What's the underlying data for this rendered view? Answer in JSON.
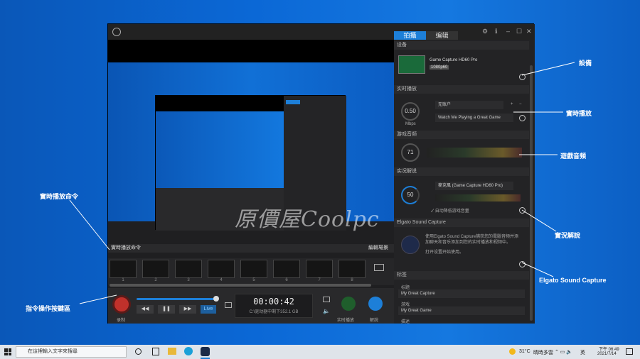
{
  "app": {
    "tabs": [
      {
        "label": "拍攝"
      },
      {
        "label": "编辑"
      }
    ],
    "watermark": "原價屋Coolpc"
  },
  "command_bar": {
    "label": "實時播放命令",
    "edit_scene": "編輯場景"
  },
  "thumbnails": [
    "1",
    "2",
    "3",
    "4",
    "5",
    "6",
    "7",
    "8"
  ],
  "controls": {
    "record_label": "录制",
    "live_label": "Live",
    "time": "00:00:42",
    "disk": "C:\\驱动器中剩下352.1 GB",
    "stream_label": "实时播放",
    "commentary_label": "解說"
  },
  "panel": {
    "device": {
      "header": "设备",
      "name": "Game Capture HD60 Pro",
      "badge": "1080p60"
    },
    "live": {
      "header": "实时播放",
      "gauge": "0.50",
      "unit": "Mbps",
      "service": "无账户",
      "title": "Watch Me Playing a Great Game"
    },
    "game_audio": {
      "header": "游戏音频",
      "gauge": "71"
    },
    "commentary": {
      "header": "实况解说",
      "gauge": "50",
      "mic": "麥克風 (Game Capture HD60 Pro)",
      "duck": "自动降低游戏音量"
    },
    "sound_capture": {
      "header": "Elgato Sound Capture",
      "desc1": "使用Elgato Sound Capture捕获您的電腦音频并添",
      "desc2": "加聊天和音乐添加到您的实时播放和视频中。",
      "link": "打开设置开始使用。"
    },
    "tags": {
      "header": "标签",
      "title_label": "标题",
      "title_value": "My Great Capture",
      "game_label": "游戏",
      "game_value": "My Great Game",
      "desc_label": "描述"
    }
  },
  "annotations": {
    "device": "設備",
    "live": "實時播放",
    "game_audio": "遊戲音頻",
    "commentary": "實況解說",
    "sound_capture": "Elgato Sound Capture",
    "live_commands": "實時播放命令",
    "command_buttons": "指令操作按鍵區"
  },
  "taskbar": {
    "search_placeholder": "在這裡輸入文字來搜尋",
    "weather": "31°C",
    "weather_desc": "晴時多雲",
    "lang": "英",
    "time": "下午 06:49",
    "date": "2021/7/14"
  }
}
